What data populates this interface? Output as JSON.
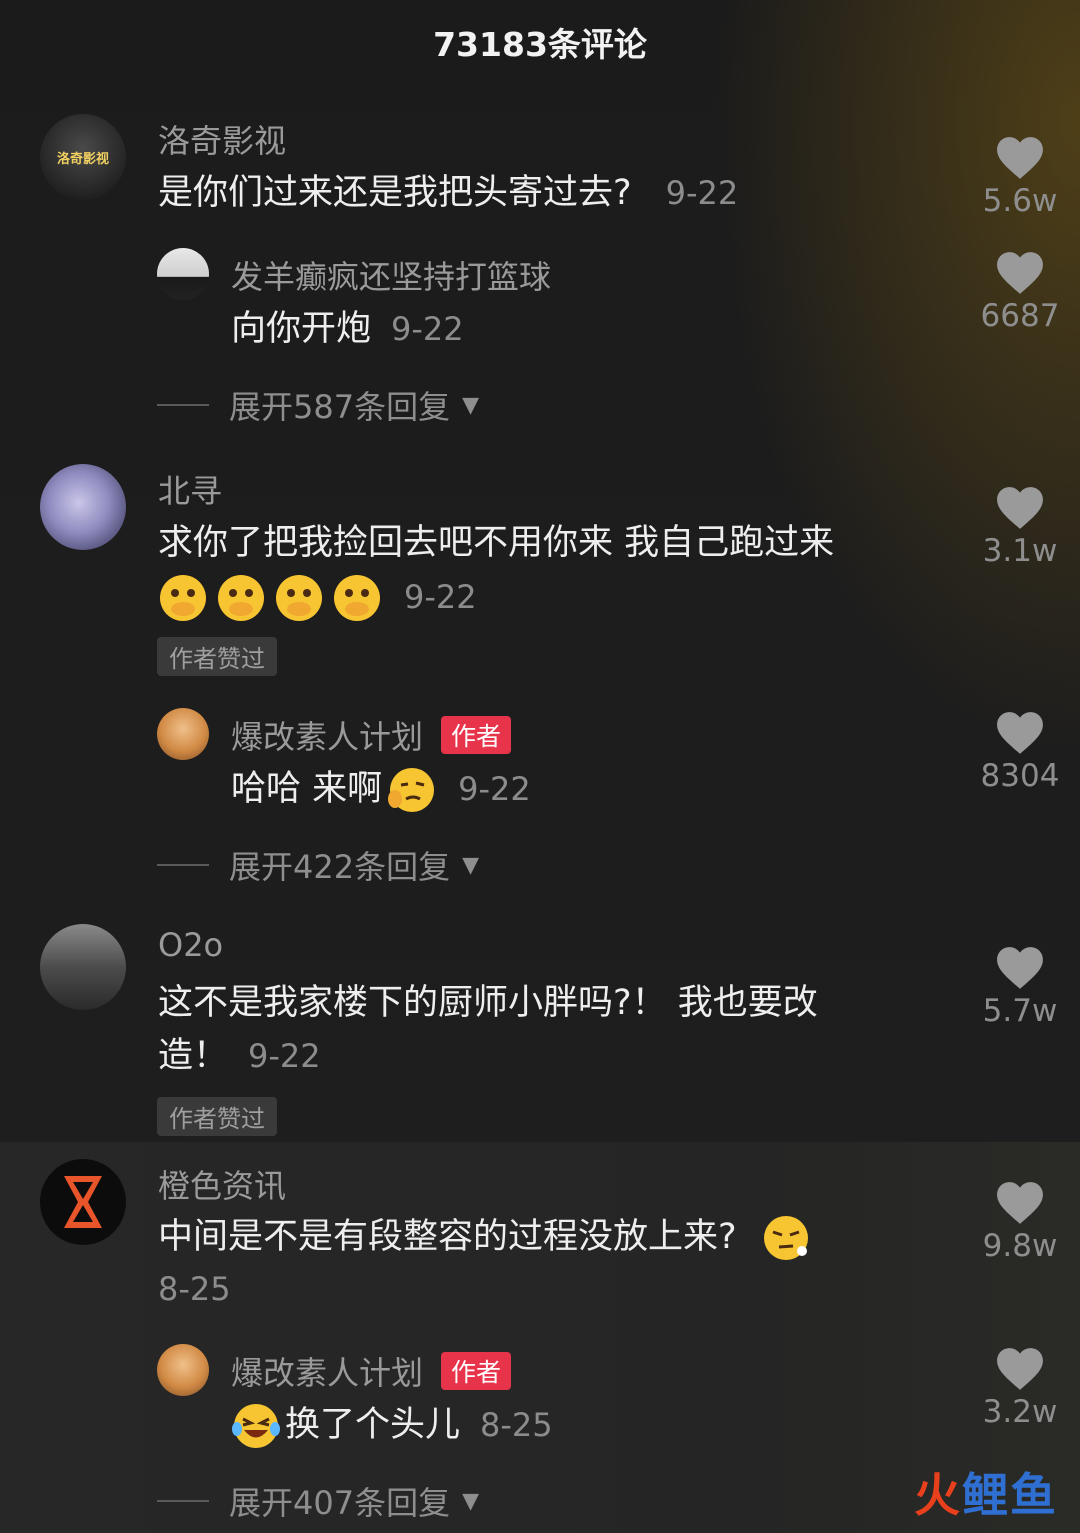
{
  "header": {
    "title": "73183条评论"
  },
  "comments": [
    {
      "name": "洛奇影视",
      "avatar_text": "洛奇影视",
      "text": "是你们过来还是我把头寄过去?",
      "date": "9-22",
      "likes": "5.6w",
      "reply": {
        "name": "发羊癫疯还坚持打篮球",
        "text": "向你开炮",
        "date": "9-22",
        "likes": "6687"
      },
      "expand_label": "展开587条回复"
    },
    {
      "name": "北寻",
      "text_line1": "求你了把我捡回去吧不用你来 我自己跑过来",
      "date": "9-22",
      "likes": "3.1w",
      "liked_tag": "作者赞过",
      "reply": {
        "name": "爆改素人计划",
        "author_tag": "作者",
        "text": "哈哈 来啊",
        "date": "9-22",
        "likes": "8304"
      },
      "expand_label": "展开422条回复"
    },
    {
      "name": "O2o",
      "text_line1": "这不是我家楼下的厨师小胖吗?！ 我也要改",
      "text_line2": "造！",
      "date": "9-22",
      "likes": "5.7w",
      "liked_tag": "作者赞过"
    },
    {
      "name": "橙色资讯",
      "text": "中间是不是有段整容的过程没放上来?",
      "date": "8-25",
      "likes": "9.8w",
      "reply": {
        "name": "爆改素人计划",
        "author_tag": "作者",
        "text": "换了个头儿",
        "date": "8-25",
        "likes": "3.2w"
      },
      "expand_label": "展开407条回复"
    }
  ],
  "watermark": {
    "part1": "火",
    "part2": "鲤鱼"
  },
  "colors": {
    "author_tag": "#e8344b",
    "emoji": "#f7c531"
  }
}
